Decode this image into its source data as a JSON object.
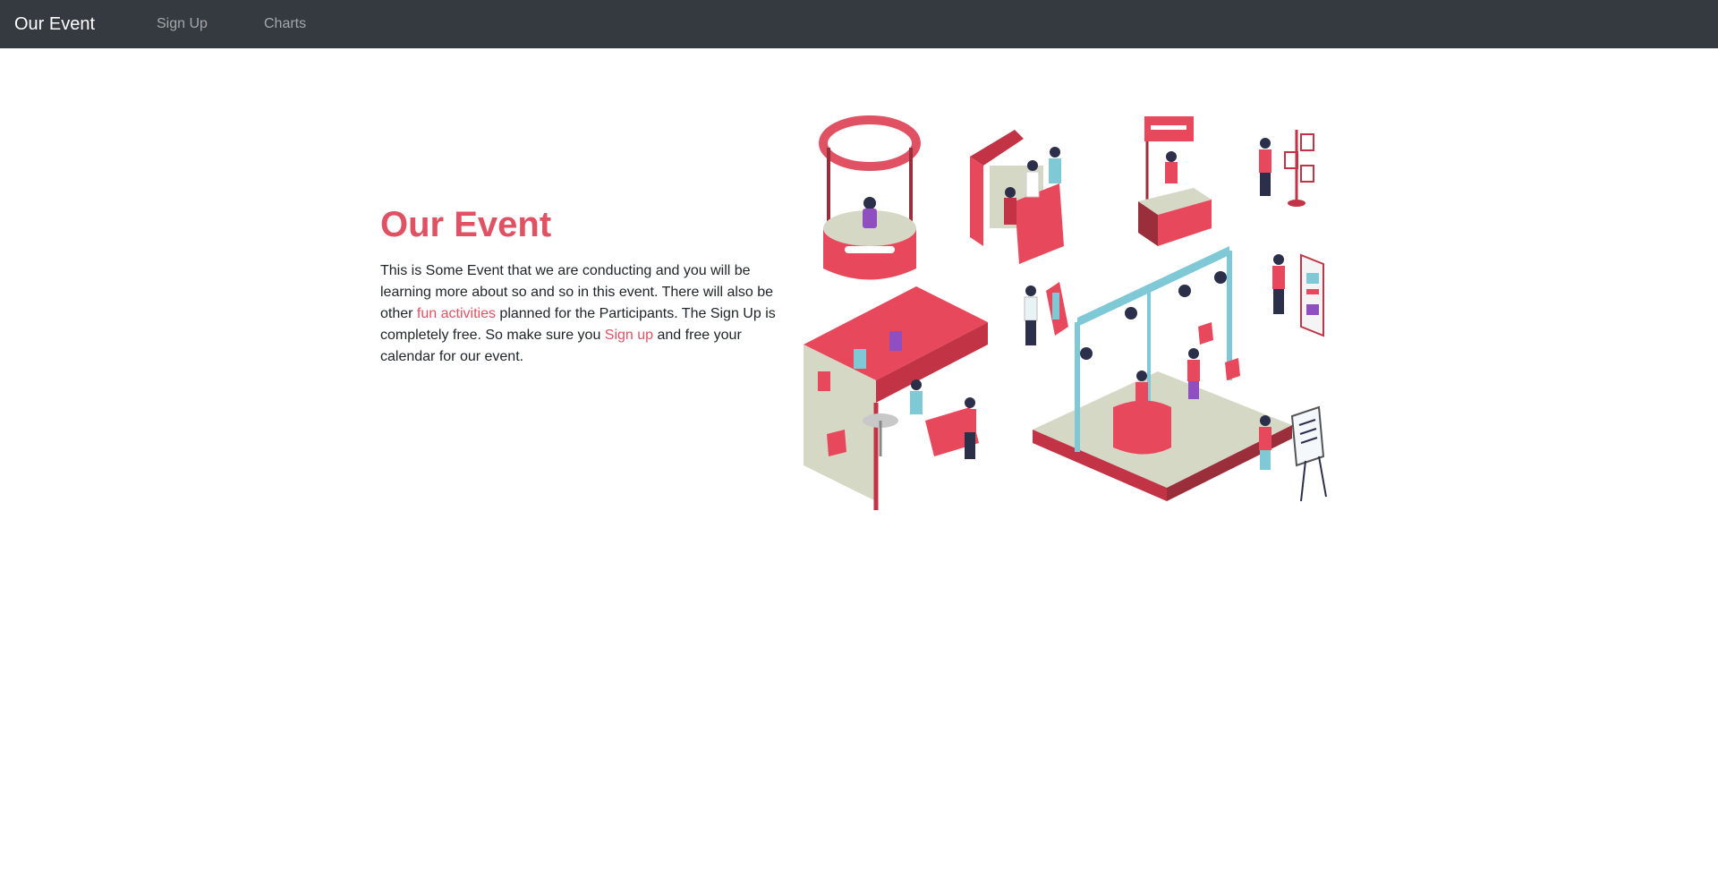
{
  "navbar": {
    "brand": "Our Event",
    "links": [
      {
        "label": "Sign Up"
      },
      {
        "label": "Charts"
      }
    ]
  },
  "hero": {
    "title": "Our Event",
    "paragraph": {
      "part1": "This is Some Event that we are conducting and you will be learning more about so and so in this event. There will also be other ",
      "link1": "fun activities",
      "part2": " planned for the Participants. The Sign Up is completely free. So make sure you ",
      "link2": "Sign up",
      "part3": " and free your calendar for our event."
    }
  },
  "colors": {
    "navbar_bg": "#343a40",
    "accent": "#e05263",
    "text": "#212529",
    "truss": "#7fc8d6",
    "booth_beige": "#d6d8c6"
  }
}
